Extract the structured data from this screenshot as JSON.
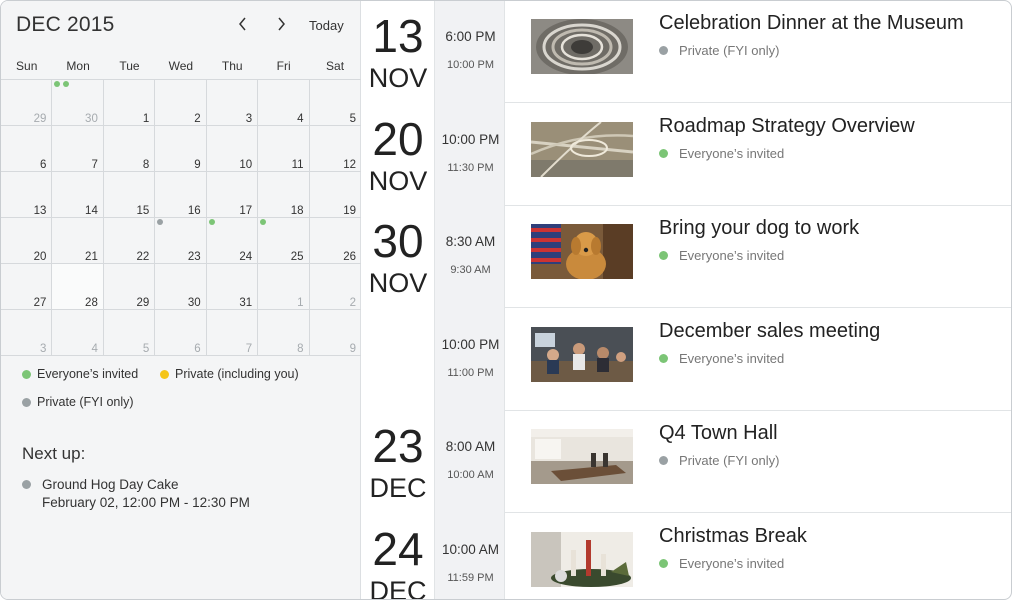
{
  "colors": {
    "everyone": "#7cc576",
    "private_you": "#f5c518",
    "fyi": "#9aa1a4"
  },
  "calendar": {
    "month_title": "DEC 2015",
    "prev_icon": "chevron-left-icon",
    "next_icon": "chevron-right-icon",
    "today_label": "Today",
    "weekdays": [
      "Sun",
      "Mon",
      "Tue",
      "Wed",
      "Thu",
      "Fri",
      "Sat"
    ],
    "weeks": [
      [
        {
          "d": "29",
          "m": true
        },
        {
          "d": "30",
          "m": true,
          "dots": [
            "everyone",
            "everyone"
          ]
        },
        {
          "d": "1"
        },
        {
          "d": "2"
        },
        {
          "d": "3"
        },
        {
          "d": "4"
        },
        {
          "d": "5"
        }
      ],
      [
        {
          "d": "6"
        },
        {
          "d": "7"
        },
        {
          "d": "8"
        },
        {
          "d": "9"
        },
        {
          "d": "10"
        },
        {
          "d": "11"
        },
        {
          "d": "12"
        }
      ],
      [
        {
          "d": "13"
        },
        {
          "d": "14"
        },
        {
          "d": "15"
        },
        {
          "d": "16"
        },
        {
          "d": "17"
        },
        {
          "d": "18"
        },
        {
          "d": "19"
        }
      ],
      [
        {
          "d": "20"
        },
        {
          "d": "21"
        },
        {
          "d": "22"
        },
        {
          "d": "23",
          "dots": [
            "fyi"
          ]
        },
        {
          "d": "24",
          "dots": [
            "everyone"
          ]
        },
        {
          "d": "25",
          "dots": [
            "everyone"
          ]
        },
        {
          "d": "26"
        }
      ],
      [
        {
          "d": "27"
        },
        {
          "d": "28",
          "selected": true
        },
        {
          "d": "29"
        },
        {
          "d": "30"
        },
        {
          "d": "31"
        },
        {
          "d": "1",
          "m": true
        },
        {
          "d": "2",
          "m": true
        }
      ],
      [
        {
          "d": "3",
          "m": true
        },
        {
          "d": "4",
          "m": true
        },
        {
          "d": "5",
          "m": true
        },
        {
          "d": "6",
          "m": true
        },
        {
          "d": "7",
          "m": true
        },
        {
          "d": "8",
          "m": true
        },
        {
          "d": "9",
          "m": true
        }
      ]
    ]
  },
  "legend": {
    "everyone": "Everyone’s invited",
    "private_you": "Private (including you)",
    "fyi": "Private (FYI only)"
  },
  "next_up": {
    "title": "Next up:",
    "event_title": "Ground Hog Day Cake",
    "event_time": "February 02, 12:00 PM - 12:30 PM"
  },
  "events": [
    {
      "day": "13",
      "month": "NOV",
      "start": "6:00 PM",
      "end": "10:00 PM",
      "title": "Celebration Dinner at the Museum",
      "status": "Private (FYI only)",
      "kind": "fyi",
      "image": "museum-staircase"
    },
    {
      "day": "20",
      "month": "NOV",
      "start": "10:00 PM",
      "end": "11:30 PM",
      "title": "Roadmap Strategy Overview",
      "status": "Everyone’s invited",
      "kind": "everyone",
      "image": "highway-interchange"
    },
    {
      "day": "30",
      "month": "NOV",
      "start": "8:30 AM",
      "end": "9:30 AM",
      "title": "Bring your dog to work",
      "status": "Everyone’s invited",
      "kind": "everyone",
      "image": "golden-retriever-flag"
    },
    {
      "day": "",
      "month": "",
      "start": "10:00 PM",
      "end": "11:00 PM",
      "title": "December sales meeting",
      "status": "Everyone’s invited",
      "kind": "everyone",
      "image": "business-meeting"
    },
    {
      "day": "23",
      "month": "DEC",
      "start": "8:00 AM",
      "end": "10:00 AM",
      "title": "Q4 Town Hall",
      "status": "Private (FYI only)",
      "kind": "fyi",
      "image": "conference-room"
    },
    {
      "day": "24",
      "month": "DEC",
      "start": "10:00 AM",
      "end": "11:59 PM",
      "title": "Christmas Break",
      "status": "Everyone’s invited",
      "kind": "everyone",
      "image": "christmas-table"
    }
  ]
}
